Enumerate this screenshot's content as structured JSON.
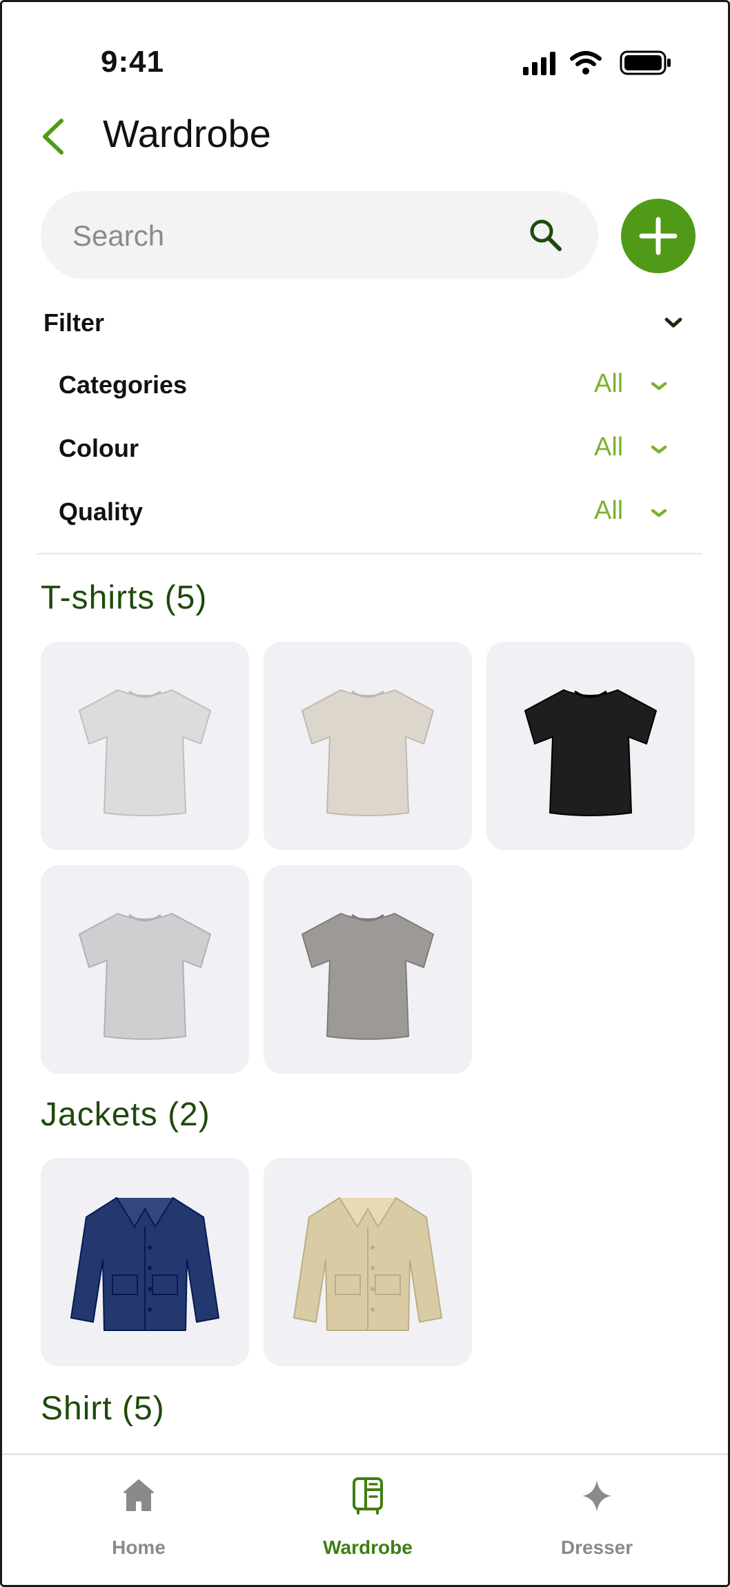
{
  "status_bar": {
    "time": "9:41"
  },
  "header": {
    "title": "Wardrobe",
    "back_icon": "chevron-left-icon"
  },
  "search": {
    "placeholder": "Search",
    "value": "",
    "icon": "search-icon"
  },
  "add_button": {
    "icon": "plus-icon"
  },
  "filter": {
    "title": "Filter",
    "rows": [
      {
        "label": "Categories",
        "value": "All"
      },
      {
        "label": "Colour",
        "value": "All"
      },
      {
        "label": "Quality",
        "value": "All"
      }
    ]
  },
  "sections": [
    {
      "title": "T-shirts (5)",
      "items": [
        {
          "kind": "tshirt",
          "color": "#dcdcdc"
        },
        {
          "kind": "tshirt",
          "color": "#ddd6cc"
        },
        {
          "kind": "tshirt",
          "color": "#1e1e1e"
        },
        {
          "kind": "tshirt",
          "color": "#cfcfd2"
        },
        {
          "kind": "tshirt",
          "color": "#9d9997"
        }
      ]
    },
    {
      "title": "Jackets (2)",
      "items": [
        {
          "kind": "jacket",
          "color": "#23386e"
        },
        {
          "kind": "jacket",
          "color": "#d9cba3"
        }
      ]
    },
    {
      "title": "Shirt (5)",
      "items": []
    }
  ],
  "tab_bar": {
    "tabs": [
      {
        "label": "Home",
        "icon": "home-icon",
        "active": false
      },
      {
        "label": "Wardrobe",
        "icon": "wardrobe-icon",
        "active": true
      },
      {
        "label": "Dresser",
        "icon": "sparkle-icon",
        "active": false
      }
    ]
  },
  "colors": {
    "accent": "#4f9a16",
    "accent_light": "#7ab32e",
    "section_title": "#1e4a0c",
    "card_bg": "#f1f0f5",
    "search_bg": "#f3f3f4",
    "tab_inactive": "#8a8a8a",
    "tab_active": "#3f7e12"
  }
}
